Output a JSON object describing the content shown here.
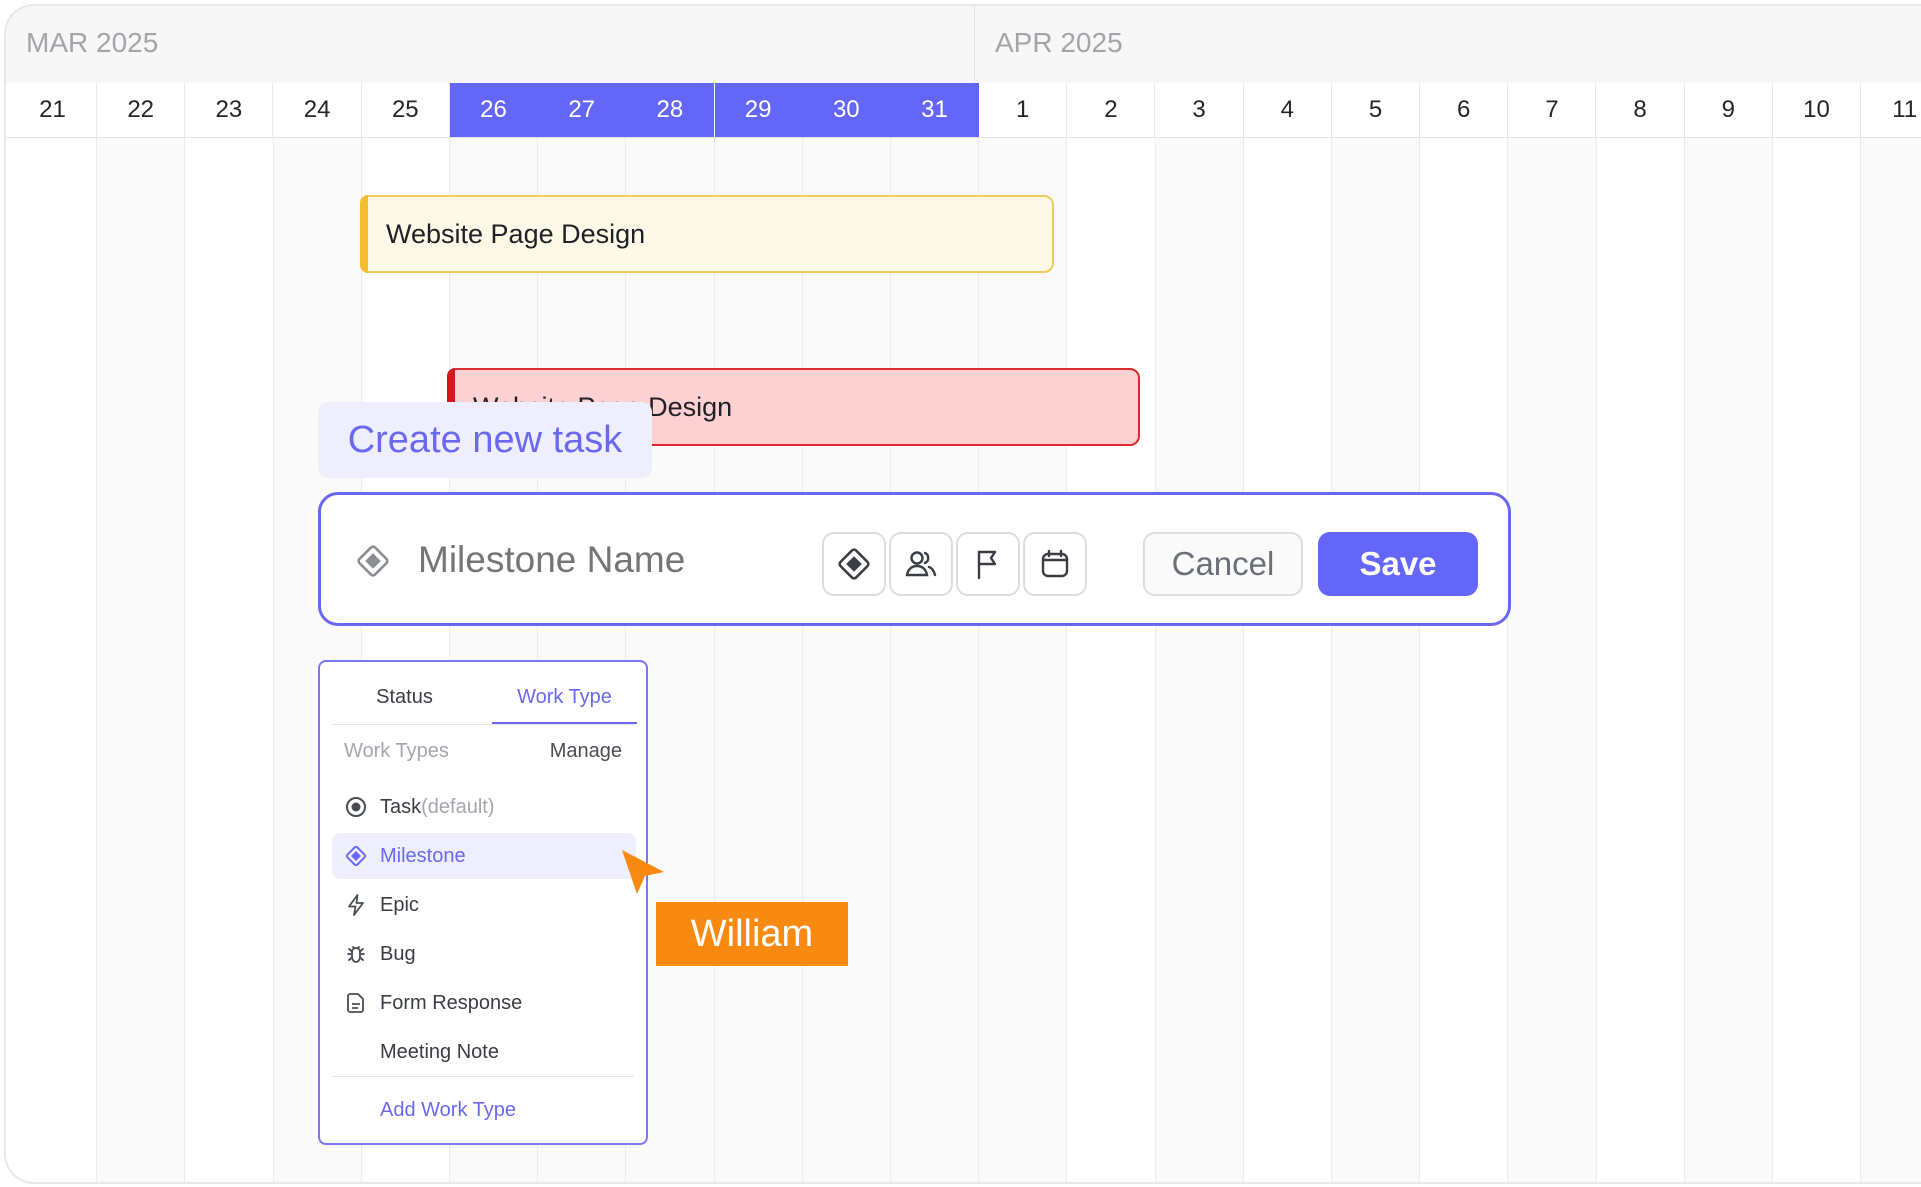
{
  "timeline": {
    "months": [
      {
        "label": "MAR 2025"
      },
      {
        "label": "APR 2025"
      }
    ],
    "days": [
      {
        "label": "21",
        "highlighted": false
      },
      {
        "label": "22",
        "highlighted": false
      },
      {
        "label": "23",
        "highlighted": false
      },
      {
        "label": "24",
        "highlighted": false
      },
      {
        "label": "25",
        "highlighted": false
      },
      {
        "label": "26",
        "highlighted": true
      },
      {
        "label": "27",
        "highlighted": true
      },
      {
        "label": "28",
        "highlighted": true
      },
      {
        "label": "29",
        "highlighted": true
      },
      {
        "label": "30",
        "highlighted": true
      },
      {
        "label": "31",
        "highlighted": true
      },
      {
        "label": "1",
        "highlighted": false
      },
      {
        "label": "2",
        "highlighted": false
      },
      {
        "label": "3",
        "highlighted": false
      },
      {
        "label": "4",
        "highlighted": false
      },
      {
        "label": "5",
        "highlighted": false
      },
      {
        "label": "6",
        "highlighted": false
      },
      {
        "label": "7",
        "highlighted": false
      },
      {
        "label": "8",
        "highlighted": false
      },
      {
        "label": "9",
        "highlighted": false
      },
      {
        "label": "10",
        "highlighted": false
      },
      {
        "label": "11",
        "highlighted": false
      }
    ]
  },
  "bars": [
    {
      "label": "Website Page Design",
      "color": "#f3bd2f"
    },
    {
      "label": "Website Page Design",
      "color": "#d4181e"
    }
  ],
  "create_task": {
    "label": "Create new task",
    "placeholder": "Milestone Name",
    "tool_icons": [
      "milestone-diamond-icon",
      "assignees-icon",
      "priority-flag-icon",
      "calendar-icon"
    ],
    "cancel_label": "Cancel",
    "save_label": "Save"
  },
  "work_type_menu": {
    "tabs": [
      "Status",
      "Work Type"
    ],
    "active_tab": "Work Type",
    "section_label": "Work Types",
    "manage_label": "Manage",
    "items": [
      {
        "label": "Task",
        "suffix": "(default)",
        "icon": "radio-dot-icon",
        "selected": false
      },
      {
        "label": "Milestone",
        "suffix": "",
        "icon": "diamond-icon",
        "selected": true
      },
      {
        "label": "Epic",
        "suffix": "",
        "icon": "lightning-icon",
        "selected": false
      },
      {
        "label": "Bug",
        "suffix": "",
        "icon": "bug-icon",
        "selected": false
      },
      {
        "label": "Form Response",
        "suffix": "",
        "icon": "document-icon",
        "selected": false
      },
      {
        "label": "Meeting Note",
        "suffix": "",
        "icon": "",
        "selected": false
      }
    ],
    "add_label": "Add Work Type"
  },
  "cursor": {
    "name": "William",
    "color": "#f98a11"
  },
  "colors": {
    "accent": "#6366f6",
    "grid": "#ececee"
  }
}
